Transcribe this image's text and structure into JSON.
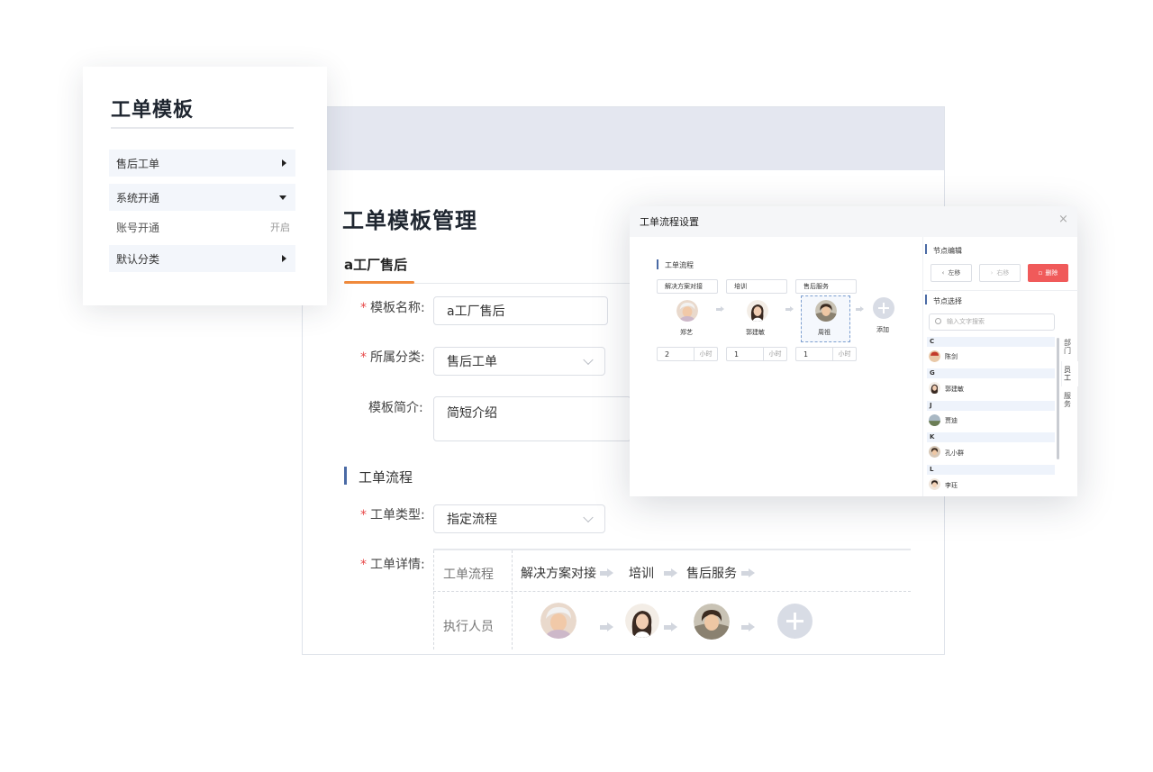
{
  "template_card": {
    "title": "工单模板",
    "menu": [
      {
        "label": "售后工单"
      },
      {
        "label": "系统开通"
      },
      {
        "label": "默认分类"
      }
    ],
    "sub_item": {
      "label": "账号开通",
      "status": "开启"
    }
  },
  "main": {
    "title": "工单模板管理",
    "tab": "a工厂售后",
    "form": {
      "name_label": "模板名称:",
      "name_value": "a工厂售后",
      "category_label": "所属分类:",
      "category_value": "售后工单",
      "intro_label": "模板简介:",
      "intro_value": "简短介绍",
      "section_title": "工单流程",
      "type_label": "工单类型:",
      "type_value": "指定流程",
      "detail_label": "工单详情:"
    },
    "detail_table": {
      "flow_label": "工单流程",
      "steps": [
        "解决方案对接",
        "培训",
        "售后服务"
      ],
      "executor_label": "执行人员"
    }
  },
  "dialog": {
    "title": "工单流程设置",
    "close": "×",
    "flow_title": "工单流程",
    "steps": [
      {
        "name": "解决方案对接",
        "person": "郑艺",
        "hours": "2"
      },
      {
        "name": "培训",
        "person": "郭建敏",
        "hours": "1"
      },
      {
        "name": "售后服务",
        "person": "周祖",
        "hours": "1"
      }
    ],
    "hour_unit": "小时",
    "add_label": "添加",
    "node_edit": {
      "title": "节点编辑",
      "left_btn": "左移",
      "right_btn": "右移",
      "delete_btn": "删除"
    },
    "node_select": {
      "title": "节点选择",
      "search_placeholder": "输入文字搜索",
      "groups": [
        {
          "letter": "C",
          "person": "陈剑"
        },
        {
          "letter": "G",
          "person": "郭建敏"
        },
        {
          "letter": "J",
          "person": "贾迪"
        },
        {
          "letter": "K",
          "person": "孔小群"
        },
        {
          "letter": "L",
          "person": "李珏"
        }
      ],
      "side_tabs": [
        "部门",
        "员工",
        "服务"
      ]
    }
  },
  "colors": {
    "accent_orange": "#f08a3c",
    "section_blue": "#4a6aa5",
    "required_red": "#e84a4a",
    "delete_red": "#f05a5a",
    "header_band": "#e4e7f0"
  }
}
